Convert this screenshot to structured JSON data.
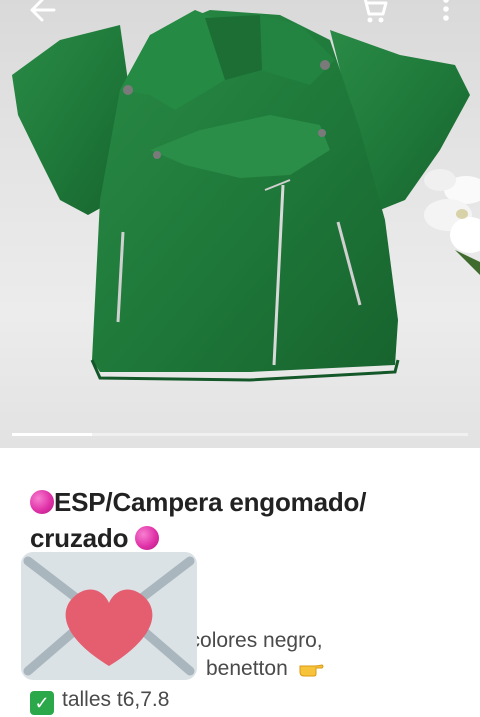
{
  "topbar": {
    "back_icon": "arrow-left-icon",
    "cart_icon": "shopping-cart-icon",
    "more_icon": "more-vertical-icon"
  },
  "gallery": {
    "image_alt": "green jacket with zippers on white background with flowers",
    "current_index": 1
  },
  "product": {
    "title_line1": "ESP/Campera engomado/",
    "title_line2": "cruzado",
    "desc_line1_text": "colores negro,",
    "desc_line2_text": "benetton",
    "desc_line3_text": "talles t6,7.8",
    "exclamation": "‼"
  },
  "floating": {
    "icon": "envelope-heart-icon"
  },
  "colors": {
    "jacket": "#1f7a3a",
    "title": "#222222",
    "desc": "#4a4a4a",
    "dot": "#e032a8",
    "heart": "#e45e6f",
    "envelope": "#dbe2e6",
    "check": "#2aa84a"
  }
}
